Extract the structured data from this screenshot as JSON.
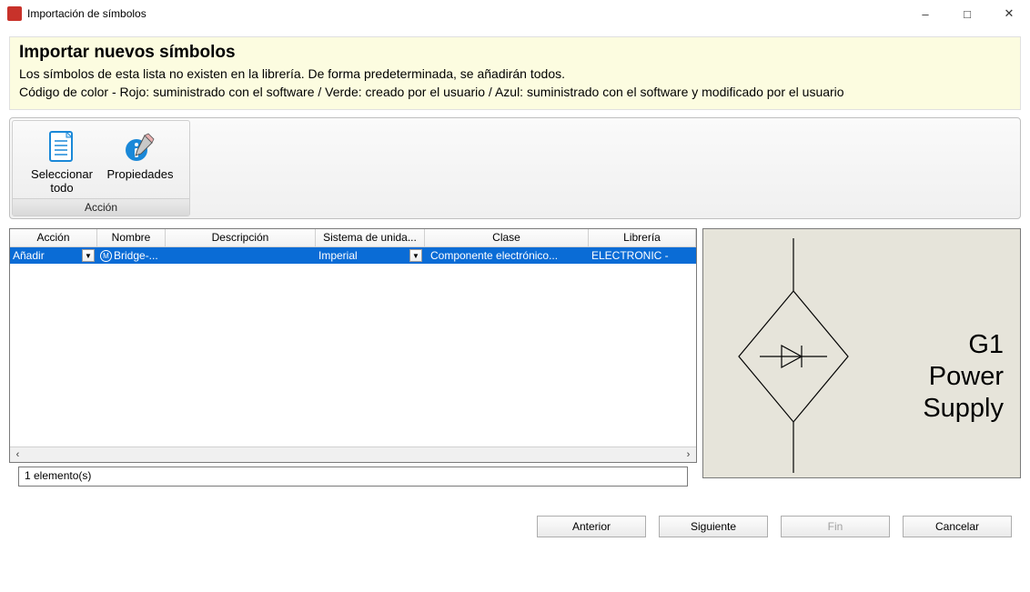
{
  "window": {
    "title": "Importación de símbolos"
  },
  "banner": {
    "heading": "Importar nuevos símbolos",
    "line1": "Los símbolos de esta lista no existen en la librería. De forma predeterminada, se añadirán todos.",
    "line2": "Código de color - Rojo: suministrado con el software / Verde: creado por el usuario / Azul: suministrado con el software y modificado por el usuario"
  },
  "ribbon": {
    "group_label": "Acción",
    "select_all": "Seleccionar todo",
    "properties": "Propiedades"
  },
  "grid": {
    "headers": {
      "accion": "Acción",
      "nombre": "Nombre",
      "descripcion": "Descripción",
      "sistema": "Sistema de unida...",
      "clase": "Clase",
      "libreria": "Librería"
    },
    "row": {
      "accion": "Añadir",
      "nombre": "Bridge-...",
      "descripcion": "",
      "sistema": "Imperial",
      "clase": "Componente electrónico...",
      "libreria": "ELECTRONIC -"
    }
  },
  "preview": {
    "line1": "G1",
    "line2": "Power",
    "line3": "Supply"
  },
  "status": "1 elemento(s)",
  "buttons": {
    "previous": "Anterior",
    "next": "Siguiente",
    "finish": "Fin",
    "cancel": "Cancelar"
  }
}
